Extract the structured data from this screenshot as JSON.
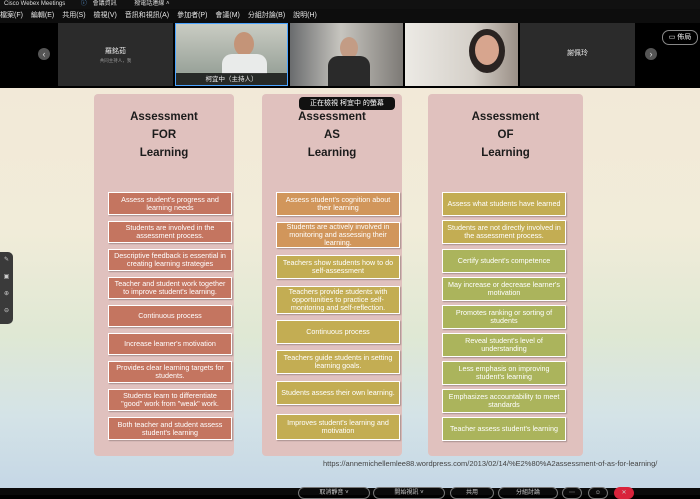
{
  "titlebar": {
    "app_title": "Cisco Webex Meetings",
    "info": "會議資訊",
    "status": "撥電話連線 ˄"
  },
  "menubar": {
    "items": [
      "檔案(F)",
      "編輯(E)",
      "共用(S)",
      "檢視(V)",
      "音訊和視訊(A)",
      "參加者(P)",
      "會議(M)",
      "分組討論(B)",
      "說明(H)"
    ]
  },
  "video_strip": {
    "tiles": [
      {
        "name": "羅銘茹",
        "sub": "共同主持人，我"
      },
      {
        "name": "柯宜中（主持人）"
      },
      {
        "name": ""
      },
      {
        "name": ""
      },
      {
        "name": "謝佩玲"
      }
    ],
    "layout_button": "▭ 佈局"
  },
  "share_banner": "正在檢視 柯宜中 的螢幕",
  "slide": {
    "columns": [
      {
        "title_lines": [
          "Assessment",
          "FOR",
          "Learning"
        ],
        "items": [
          "Assess student's progress and learning needs",
          "Students are involved in the assessment process.",
          "Descriptive feedback is essential in creating learning strategies",
          "Teacher and student work together to improve student's learning.",
          "Continuous process",
          "Increase learner's motivation",
          "Provides clear learning targets for students.",
          "Students learn to differentiate \"good\" work from \"weak\" work.",
          "Both teacher and student assess student's learning"
        ]
      },
      {
        "title_lines": [
          "Assessment",
          "AS",
          "Learning"
        ],
        "items": [
          "Assess student's cognition about their learning",
          "Students are actively involved in monitoring and assessing their learning.",
          "Teachers show students how to do self-assessment",
          "Teachers provide students with opportunities to practice self-monitoring and self-reflection.",
          "Continuous process",
          "Teachers guide students in setting learning goals.",
          "Students assess their own learning.",
          "Improves student's learning and motivation"
        ]
      },
      {
        "title_lines": [
          "Assessment",
          "OF",
          "Learning"
        ],
        "items": [
          "Assess what students have learned",
          "Students are not directly involved in the assessment process.",
          "Certify student's competence",
          "May increase or decrease learner's motivation",
          "Promotes ranking or sorting of students",
          "Reveal student's level of understanding",
          "Less emphasis on improving student's learning",
          "Emphasizes accountability to meet standards",
          "Teacher assess student's learning"
        ]
      }
    ],
    "source_url": "https://annemichellemlee88.wordpress.com/2013/02/14/%E2%80%A2assessment-of-as-for-learning/"
  },
  "bottom_bar": {
    "buttons": [
      "取消靜音 ˅",
      "開始視訊 ˅",
      "共用",
      "分組討論"
    ]
  }
}
